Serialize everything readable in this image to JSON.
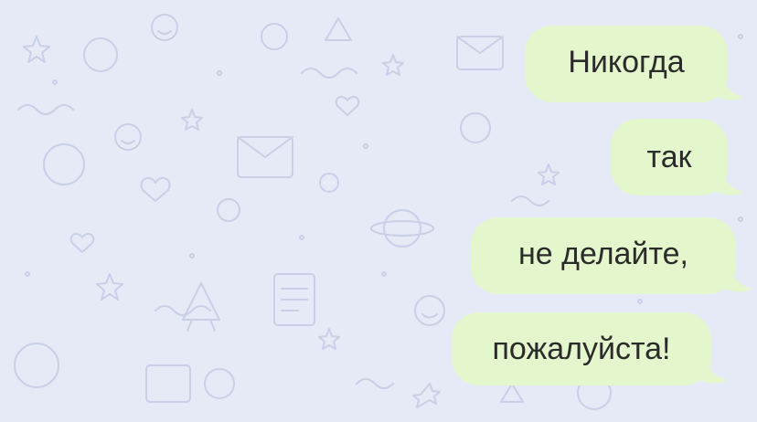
{
  "chat": {
    "messages": [
      {
        "text": "Никогда"
      },
      {
        "text": "так"
      },
      {
        "text": "не делайте,"
      },
      {
        "text": "пожалуйста!"
      }
    ]
  },
  "colors": {
    "background": "#e6eaf7",
    "bubble_outgoing": "#e3f6cc",
    "text": "#2b2b2b",
    "doodle": "#c9cfe6"
  },
  "icons": [
    "chat-wallpaper-doodles"
  ]
}
